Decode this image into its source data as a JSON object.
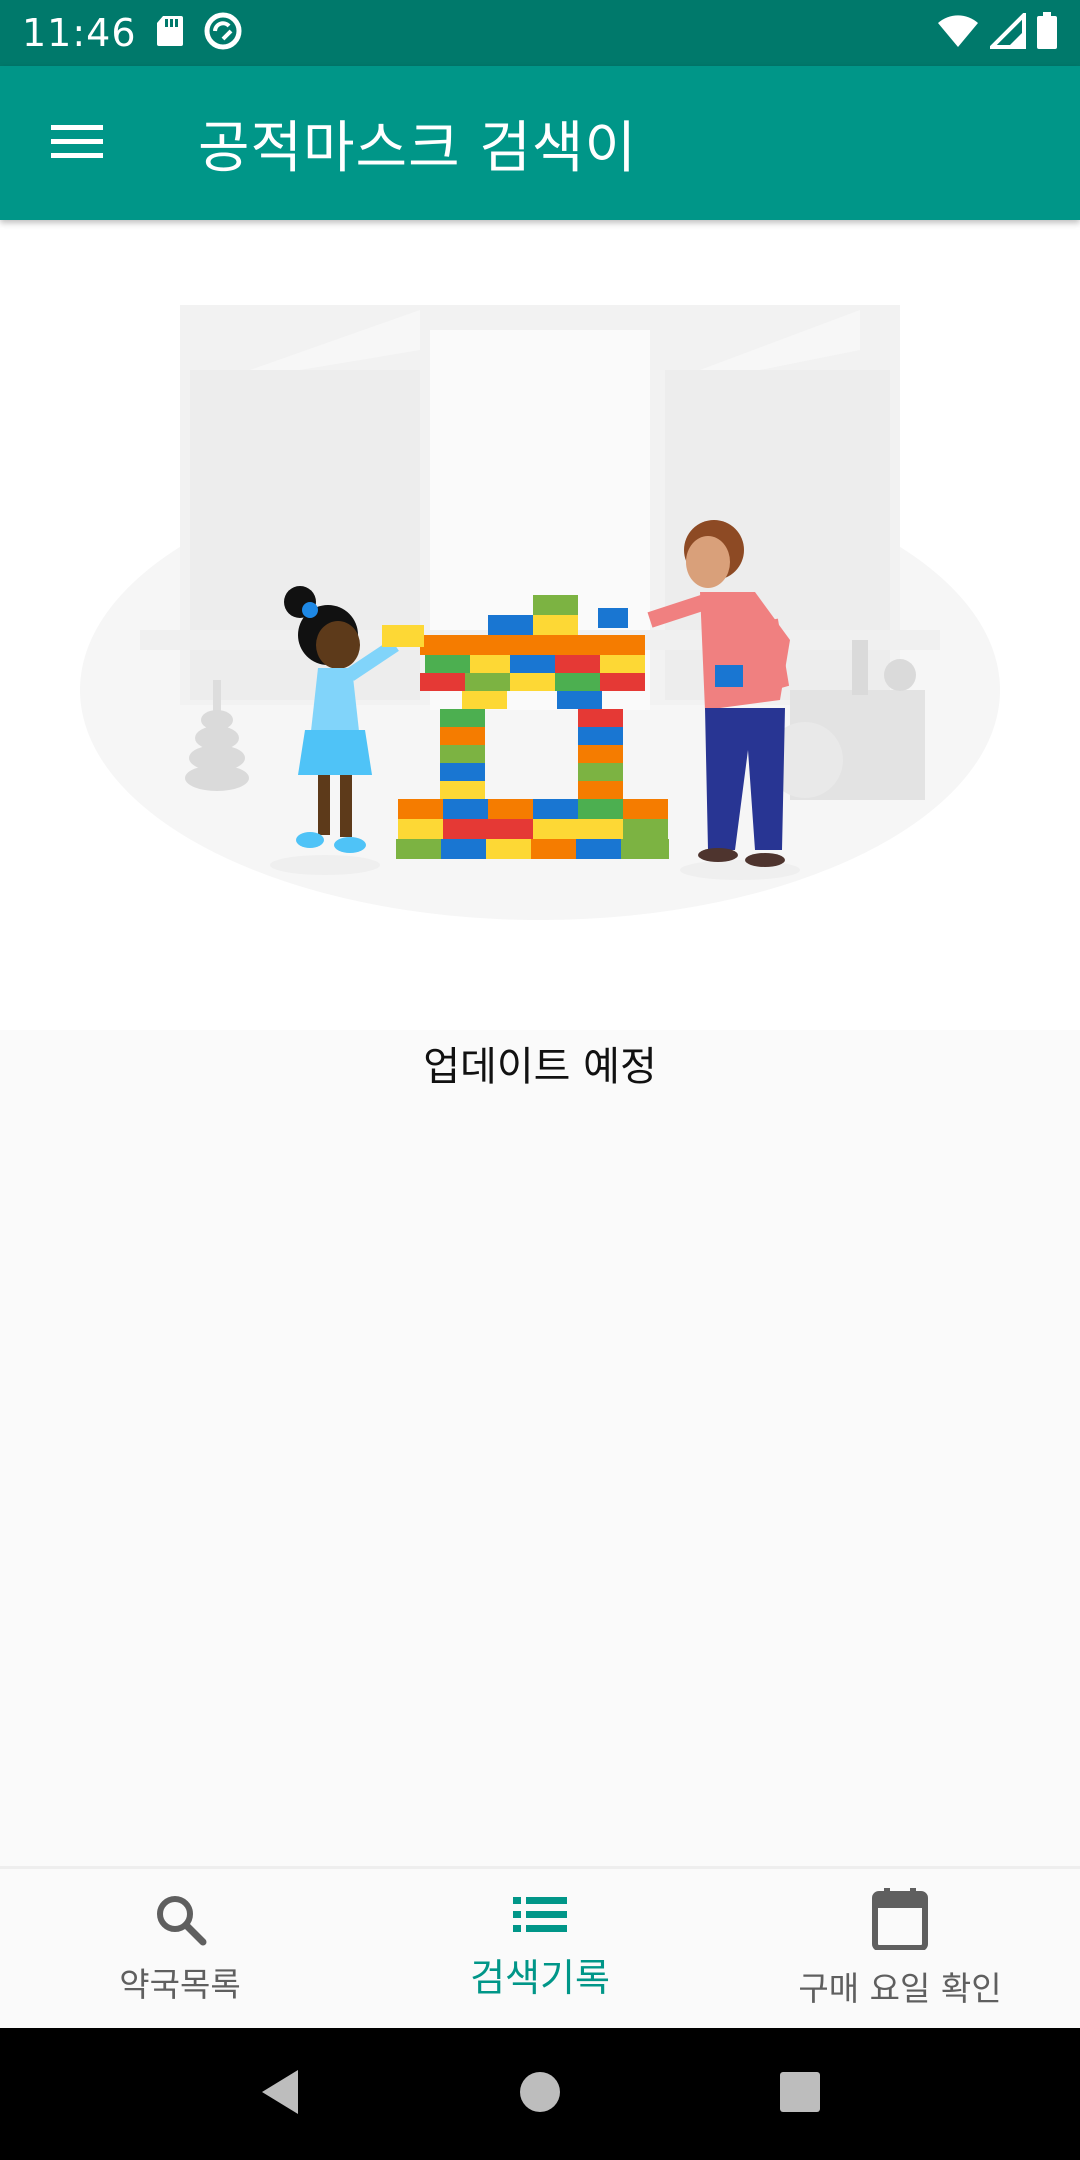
{
  "status_bar": {
    "time": "11:46",
    "icons": [
      "sd-card-icon",
      "sync-icon",
      "wifi-icon",
      "signal-icon",
      "battery-icon"
    ]
  },
  "app_bar": {
    "menu_icon": "menu-icon",
    "title": "공적마스크 검색이"
  },
  "content": {
    "illustration": "kids-building-blocks-illustration",
    "message": "업데이트 예정"
  },
  "bottom_nav": {
    "items": [
      {
        "label": "약국목록",
        "icon": "search-icon",
        "active": false
      },
      {
        "label": "검색기록",
        "icon": "list-icon",
        "active": true
      },
      {
        "label": "구매 요일 확인",
        "icon": "calendar-icon",
        "active": false
      }
    ]
  },
  "colors": {
    "primary": "#009688",
    "primary_dark": "#00796B",
    "nav_inactive": "#5F5F5F",
    "background": "#FAFAFA"
  },
  "system_nav": {
    "buttons": [
      "back-icon",
      "home-icon",
      "recents-icon"
    ]
  }
}
